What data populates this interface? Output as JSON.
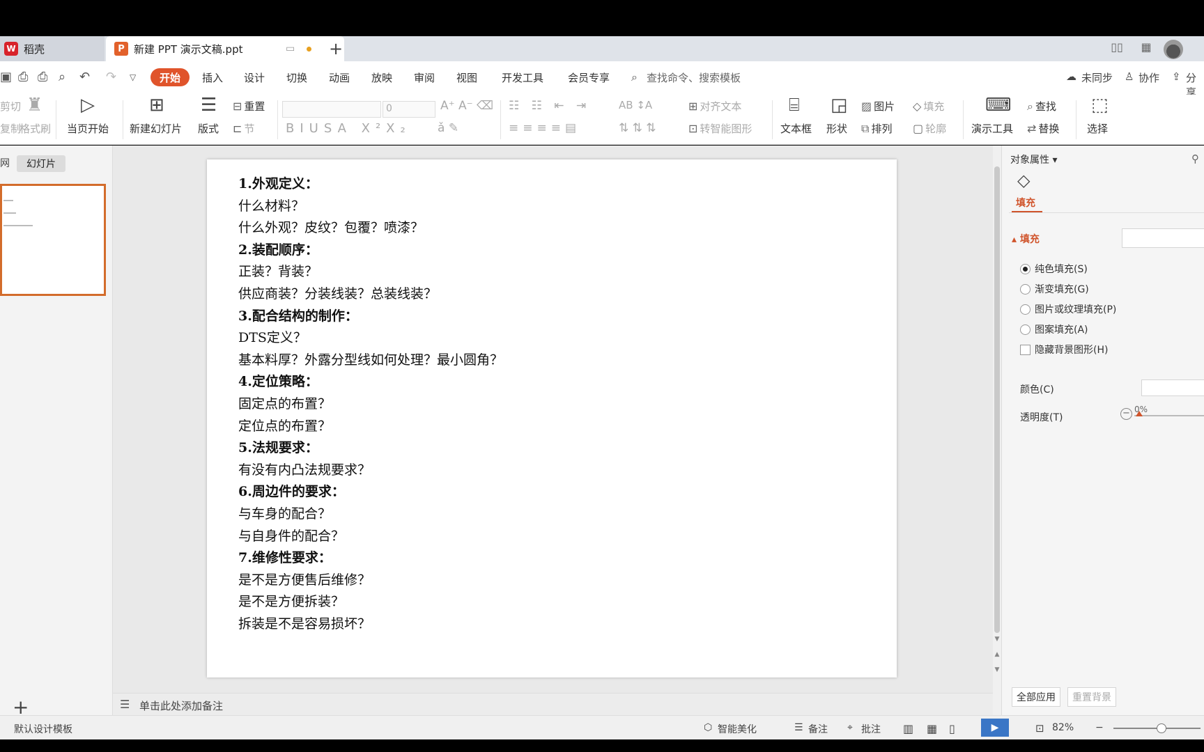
{
  "tabs": {
    "inactive_label": "稻壳",
    "active_label": "新建 PPT 演示文稿.ppt",
    "new_tab": "+"
  },
  "menu": {
    "items": [
      "开始",
      "插入",
      "设计",
      "切换",
      "动画",
      "放映",
      "审阅",
      "视图",
      "开发工具",
      "会员专享"
    ],
    "search_placeholder": "查找命令、搜索模板",
    "sync": "未同步",
    "collab": "协作",
    "share": "分享"
  },
  "ribbon": {
    "cut": "剪切",
    "copy": "复制",
    "format_painter": "格式刷",
    "play_from_current": "当页开始",
    "new_slide": "新建幻灯片",
    "layout": "版式",
    "reset": "重置",
    "section": "节",
    "font_size": "0",
    "align_text": "对齐文本",
    "smart_art": "转智能图形",
    "textbox": "文本框",
    "shape": "形状",
    "picture": "图片",
    "fill": "填充",
    "arrange": "排列",
    "outline": "轮廓",
    "presentation_tools": "演示工具",
    "find": "查找",
    "replace": "替换",
    "select": "选择"
  },
  "left_panel": {
    "outline_tab": "网",
    "slides_tab": "幻灯片",
    "add": "+"
  },
  "slide": {
    "lines": [
      {
        "text": "1.外观定义：",
        "bold": true
      },
      {
        "text": "什么材料？",
        "bold": false
      },
      {
        "text": "什么外观？皮纹？包覆？喷漆？",
        "bold": false
      },
      {
        "text": "2.装配顺序：",
        "bold": true
      },
      {
        "text": "正装？背装？",
        "bold": false
      },
      {
        "text": "供应商装？分装线装？总装线装？",
        "bold": false
      },
      {
        "text": "3.配合结构的制作：",
        "bold": true
      },
      {
        "text": "DTS定义？",
        "bold": false
      },
      {
        "text": "基本料厚？外露分型线如何处理？最小圆角？",
        "bold": false
      },
      {
        "text": "4.定位策略：",
        "bold": true
      },
      {
        "text": "固定点的布置？",
        "bold": false
      },
      {
        "text": "定位点的布置？",
        "bold": false
      },
      {
        "text": "5.法规要求：",
        "bold": true
      },
      {
        "text": "有没有内凸法规要求？",
        "bold": false
      },
      {
        "text": "6.周边件的要求：",
        "bold": true
      },
      {
        "text": "与车身的配合？",
        "bold": false
      },
      {
        "text": "与自身件的配合？",
        "bold": false
      },
      {
        "text": "7.维修性要求：",
        "bold": true
      },
      {
        "text": "是不是方便售后维修？",
        "bold": false
      },
      {
        "text": "是不是方便拆装？",
        "bold": false
      },
      {
        "text": "拆装是不是容易损坏？",
        "bold": false
      }
    ]
  },
  "notes": {
    "placeholder": "单击此处添加备注"
  },
  "right_panel": {
    "title": "对象属性",
    "fill_tab": "填充",
    "section": "填充",
    "options": [
      "纯色填充(S)",
      "渐变填充(G)",
      "图片或纹理填充(P)",
      "图案填充(A)"
    ],
    "selected_index": 0,
    "hide_bg": "隐藏背景图形(H)",
    "color_label": "颜色(C)",
    "transparency_label": "透明度(T)",
    "transparency_value": "0%",
    "apply_all": "全部应用",
    "reset_bg": "重置背景"
  },
  "status": {
    "template": "默认设计模板",
    "beautify": "智能美化",
    "notes": "备注",
    "comments": "批注",
    "zoom": "82%"
  },
  "colors": {
    "accent": "#e0542b",
    "play": "#3a76c6"
  }
}
